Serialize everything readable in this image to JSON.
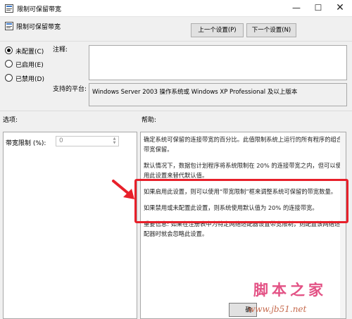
{
  "window": {
    "title": "限制可保留带宽",
    "minimize_glyph": "—",
    "maximize_glyph": "☐",
    "close_glyph": "✕"
  },
  "header": {
    "title": "限制可保留带宽",
    "prev_button": "上一个设置(P)",
    "next_button": "下一个设置(N)"
  },
  "state": {
    "options": [
      {
        "label": "未配置(C)",
        "selected": true
      },
      {
        "label": "已启用(E)",
        "selected": false
      },
      {
        "label": "已禁用(D)",
        "selected": false
      }
    ]
  },
  "comment": {
    "label": "注释:",
    "value": ""
  },
  "platform": {
    "label": "支持的平台:",
    "value": "Windows Server 2003 操作系统或 Windows XP Professional 及以上版本"
  },
  "options_section": {
    "label": "选项:",
    "bandwidth_label": "带宽限制 (%):",
    "bandwidth_value": "0",
    "spin_up": "▲",
    "spin_down": "▼"
  },
  "help_section": {
    "label": "帮助:",
    "paragraphs": [
      "确定系统可保留的连接带宽的百分比。此值限制系统上运行的所有程序的组合带宽保留。",
      "默认情况下，数据包计划程序将系统限制在 20% 的连接带宽之内，但可以使用此设置来替代默认值。",
      "如果启用此设置，则可以使用“带宽限制”框来调整系统可保留的带宽数量。",
      "如果禁用或未配置此设置，则系统使用默认值为 20% 的连接带宽。",
      "重要信息: 如果在注册表中为特定网络适配器设置带宽限制，则配置该网络适配器时就会忽略此设置。"
    ]
  },
  "footer": {
    "ok_button": "确"
  },
  "watermark": {
    "title": "脚本之家",
    "url": "www.jb51.net"
  },
  "colors": {
    "highlight": "#e8202a",
    "watermark": "#e04078"
  }
}
